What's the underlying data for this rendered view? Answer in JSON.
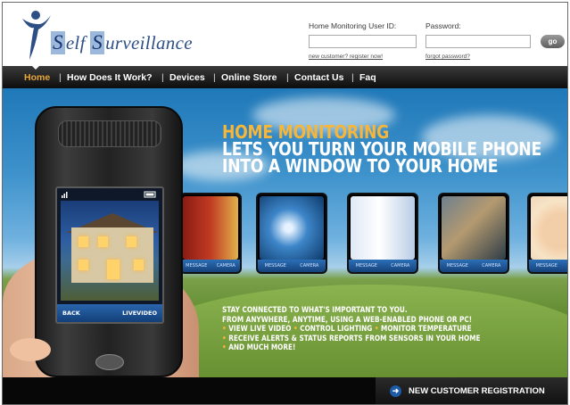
{
  "brand": {
    "logo_s": "S",
    "logo_elf": "elf ",
    "logo_s2": "S",
    "logo_urveillance": "urveillance"
  },
  "login": {
    "user_label": "Home Monitoring User ID:",
    "pass_label": "Password:",
    "go_label": "go",
    "new_customer": "new customer? register now!",
    "forgot_password": "forgot password?"
  },
  "nav": {
    "items": [
      "Home",
      "How Does It Work?",
      "Devices",
      "Online Store",
      "Contact Us",
      "Faq"
    ],
    "separator": "|",
    "active": "Home"
  },
  "hero": {
    "title_line1": "HOME MONITORING",
    "title_line2": "LETS YOU TURN YOUR MOBILE PHONE",
    "title_line3": "INTO A WINDOW TO YOUR HOME",
    "tagline1": "STAY CONNECTED TO WHAT'S IMPORTANT TO YOU.",
    "tagline2": "FROM ANYWHERE, ANYTIME, USING A WEB-ENABLED PHONE OR PC!",
    "bullet_glyph": "•",
    "bullets": [
      "VIEW LIVE VIDEO",
      "CONTROL LIGHTING",
      "MONITOR TEMPERATURE",
      "RECEIVE ALERTS & STATUS REPORTS FROM SENSORS IN YOUR HOME",
      "AND MUCH MORE!"
    ],
    "thumb_left": "MESSAGE",
    "thumb_right": "CAMERA"
  },
  "phone": {
    "back": "BACK",
    "live_video": "LIVEVIDEO"
  },
  "footer": {
    "register_label": "NEW CUSTOMER REGISTRATION",
    "register_arrow": "➜"
  },
  "colors": {
    "accent": "#e8a73a",
    "hero_title_orange": "#f5b63b",
    "logo_blue": "#2d4f86",
    "reg_icon_blue": "#1d5aa8"
  }
}
